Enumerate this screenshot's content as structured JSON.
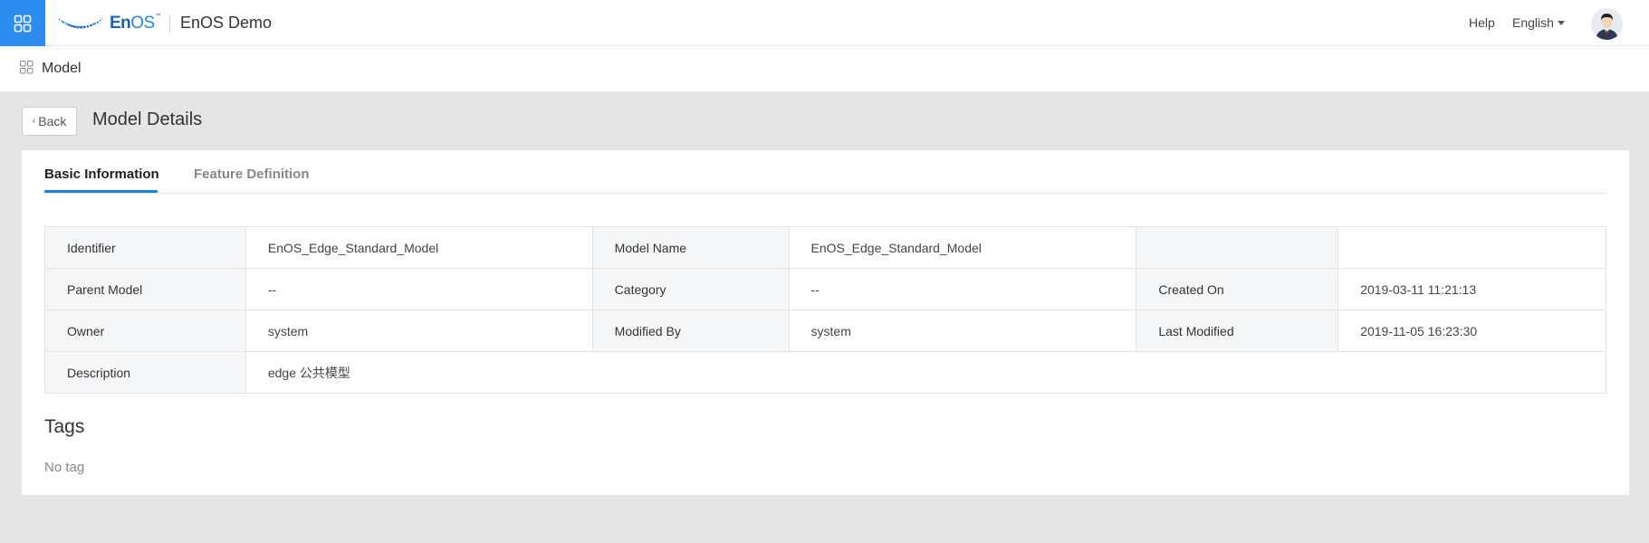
{
  "header": {
    "apps_icon": "grid-icon",
    "logo_main": "En",
    "logo_os": "OS",
    "logo_tm": "™",
    "app_title": "EnOS Demo",
    "help": "Help",
    "language": "English",
    "avatar_icon": "user-avatar"
  },
  "breadcrumb": {
    "icon": "model-icon",
    "label": "Model"
  },
  "page": {
    "back_label": "Back",
    "title": "Model Details"
  },
  "tabs": [
    {
      "label": "Basic Information",
      "active": true
    },
    {
      "label": "Feature Definition",
      "active": false
    }
  ],
  "info": {
    "identifier_label": "Identifier",
    "identifier": "EnOS_Edge_Standard_Model",
    "model_name_label": "Model Name",
    "model_name": "EnOS_Edge_Standard_Model",
    "parent_model_label": "Parent Model",
    "parent_model": "--",
    "category_label": "Category",
    "category": "--",
    "created_on_label": "Created On",
    "created_on": "2019-03-11 11:21:13",
    "owner_label": "Owner",
    "owner": "system",
    "modified_by_label": "Modified By",
    "modified_by": "system",
    "last_modified_label": "Last Modified",
    "last_modified": "2019-11-05 16:23:30",
    "description_label": "Description",
    "description": "edge 公共模型"
  },
  "tags": {
    "title": "Tags",
    "empty": "No tag"
  },
  "colors": {
    "accent": "#2d8cf0",
    "tab_underline": "#1e7ee8",
    "page_bg": "#e5e5e5",
    "label_cell_bg": "#f5f6f8"
  }
}
